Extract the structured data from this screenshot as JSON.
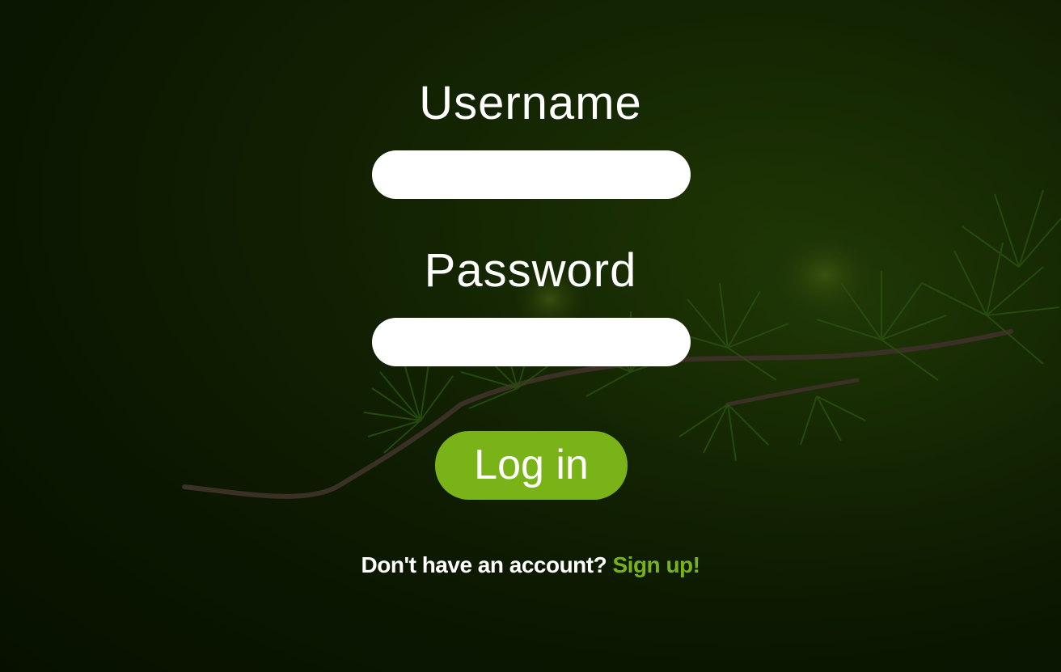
{
  "form": {
    "username_label": "Username",
    "username_value": "",
    "password_label": "Password",
    "password_value": "",
    "login_label": "Log in"
  },
  "signup": {
    "prompt": "Don't have an account?",
    "link_label": "Sign up!"
  },
  "colors": {
    "accent": "#7ab317",
    "background": "#1d3504",
    "text": "#ffffff"
  },
  "background_image": "pine-branch-photo"
}
